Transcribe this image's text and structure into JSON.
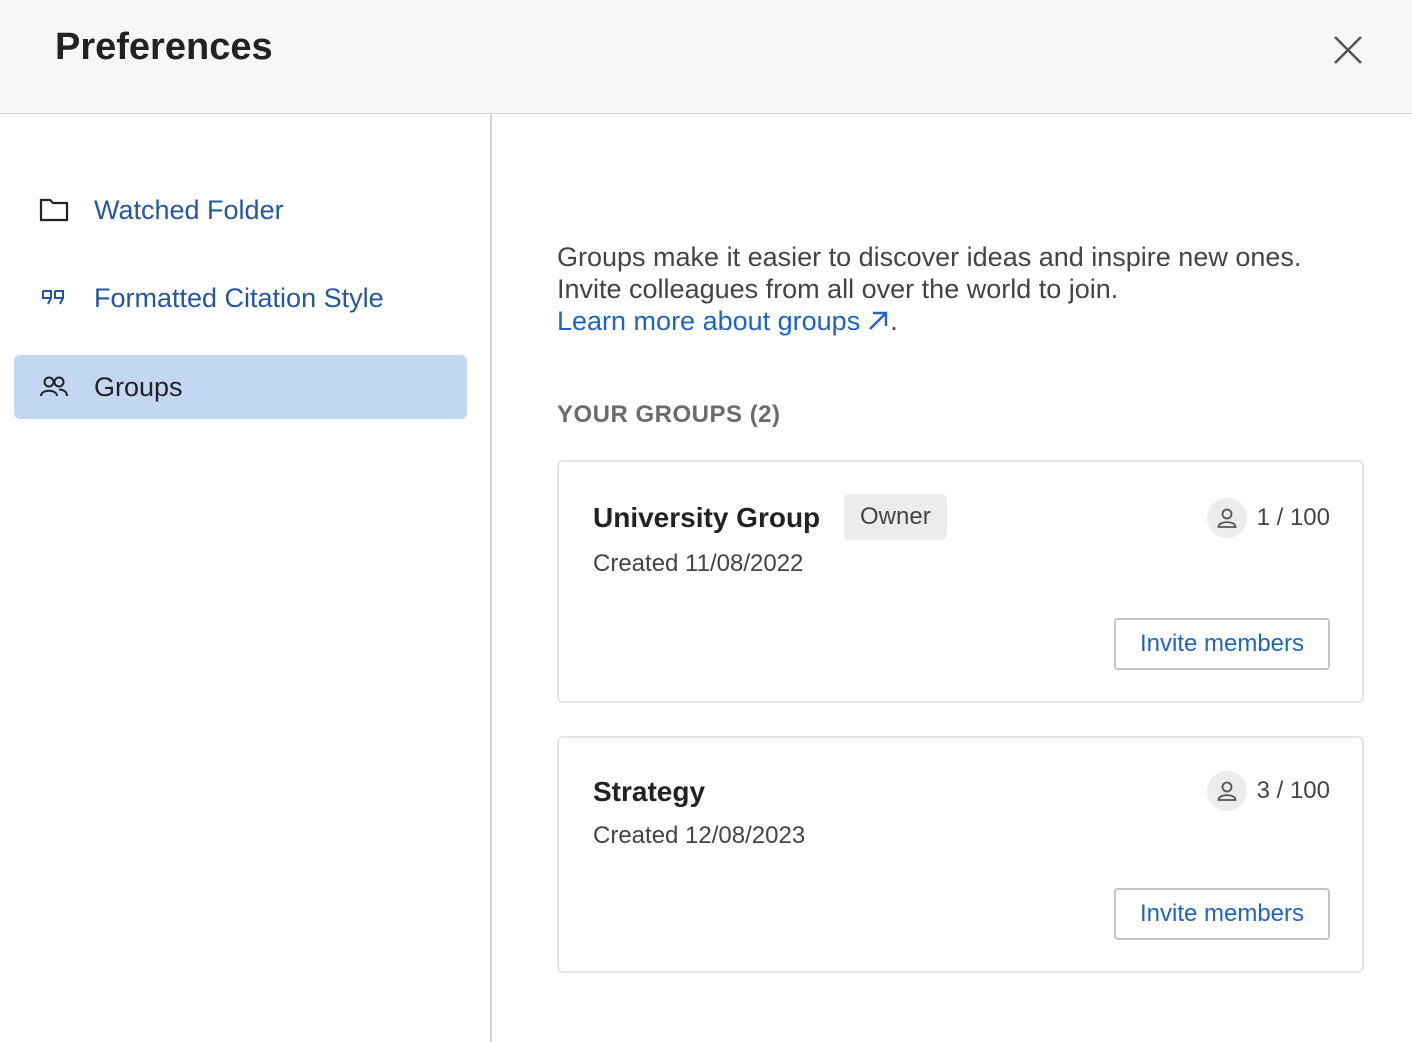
{
  "header": {
    "title": "Preferences",
    "close_icon": "close-icon"
  },
  "sidebar": {
    "items": [
      {
        "label": "Watched Folder",
        "icon": "folder-icon",
        "active": false
      },
      {
        "label": "Formatted Citation Style",
        "icon": "quote-icon",
        "active": false
      },
      {
        "label": "Groups",
        "icon": "people-icon",
        "active": true
      }
    ]
  },
  "main": {
    "intro_line1": "Groups make it easier to discover ideas and inspire new ones.",
    "intro_line2": "Invite colleagues from all over the world to join.",
    "learn_more_link": "Learn more about groups",
    "learn_more_suffix": ".",
    "section_title": "YOUR GROUPS (2)",
    "groups": [
      {
        "name": "University Group",
        "badge": "Owner",
        "created": "Created 11/08/2022",
        "members": "1 / 100",
        "invite_label": "Invite members"
      },
      {
        "name": "Strategy",
        "badge": "",
        "created": "Created 12/08/2023",
        "members": "3 / 100",
        "invite_label": "Invite members"
      }
    ]
  },
  "colors": {
    "link": "#1d64c8",
    "nav_link": "#2556a5",
    "active_bg": "#c3d7f3",
    "header_bg": "#f7f7f7"
  }
}
